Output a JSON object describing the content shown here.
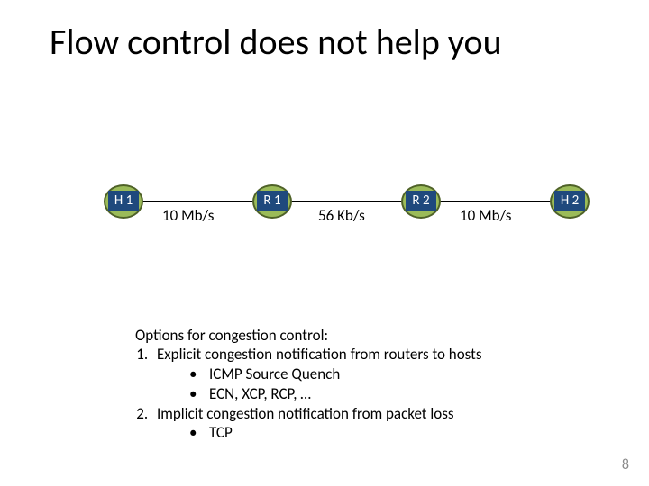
{
  "title": "Flow control does not help you",
  "nodes": {
    "h1": "H 1",
    "r1": "R 1",
    "r2": "R 2",
    "h2": "H 2"
  },
  "links": {
    "l1": "10 Mb/s",
    "l2": "56 Kb/s",
    "l3": "10 Mb/s"
  },
  "options": {
    "heading": "Options for congestion control:",
    "item1": "Explicit congestion notification from routers to hosts",
    "item1_sub1": "ICMP Source Quench",
    "item1_sub2": "ECN, XCP, RCP, …",
    "item2": "Implicit congestion notification from packet loss",
    "item2_sub1": "TCP"
  },
  "page_number": "8",
  "chart_data": {
    "type": "table",
    "description": "Network path diagram H1→R1→R2→H2 with link bandwidths",
    "nodes": [
      "H1",
      "R1",
      "R2",
      "H2"
    ],
    "links": [
      {
        "from": "H1",
        "to": "R1",
        "bandwidth": "10 Mb/s"
      },
      {
        "from": "R1",
        "to": "R2",
        "bandwidth": "56 Kb/s"
      },
      {
        "from": "R2",
        "to": "H2",
        "bandwidth": "10 Mb/s"
      }
    ]
  }
}
